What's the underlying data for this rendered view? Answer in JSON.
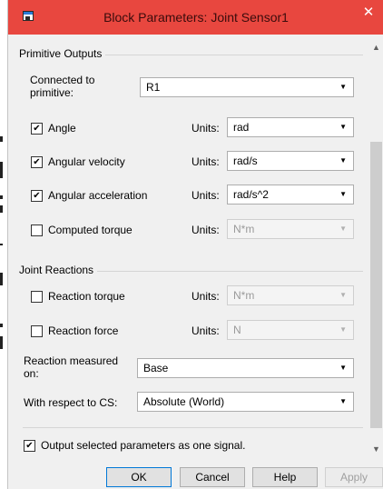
{
  "window": {
    "title": "Block Parameters: Joint Sensor1",
    "close_glyph": "✕"
  },
  "primitive_outputs": {
    "group_label": "Primitive Outputs",
    "connected_label": "Connected to primitive:",
    "connected_value": "R1",
    "rows": [
      {
        "label": "Angle",
        "checked": true,
        "units_label": "Units:",
        "units": "rad",
        "enabled": true
      },
      {
        "label": "Angular velocity",
        "checked": true,
        "units_label": "Units:",
        "units": "rad/s",
        "enabled": true
      },
      {
        "label": "Angular acceleration",
        "checked": true,
        "units_label": "Units:",
        "units": "rad/s^2",
        "enabled": true
      },
      {
        "label": "Computed torque",
        "checked": false,
        "units_label": "Units:",
        "units": "N*m",
        "enabled": false
      }
    ]
  },
  "joint_reactions": {
    "group_label": "Joint Reactions",
    "rows": [
      {
        "label": "Reaction torque",
        "checked": false,
        "units_label": "Units:",
        "units": "N*m",
        "enabled": false
      },
      {
        "label": "Reaction force",
        "checked": false,
        "units_label": "Units:",
        "units": "N",
        "enabled": false
      }
    ],
    "measured_on_label": "Reaction measured on:",
    "measured_on_value": "Base",
    "respect_cs_label": "With respect to CS:",
    "respect_cs_value": "Absolute (World)"
  },
  "output_option": {
    "label": "Output selected parameters as one signal.",
    "checked": true
  },
  "buttons": {
    "ok": "OK",
    "cancel": "Cancel",
    "help": "Help",
    "apply": "Apply"
  },
  "icons": {
    "dropdown": "chevron-down-icon",
    "scroll_up": "scroll-up-icon",
    "scroll_down": "scroll-down-icon",
    "close": "close-icon",
    "app": "simulink-block-icon"
  },
  "colors": {
    "titlebar": "#e8473f",
    "window_bg": "#f0f0f0",
    "default_button_border": "#0078d7"
  }
}
